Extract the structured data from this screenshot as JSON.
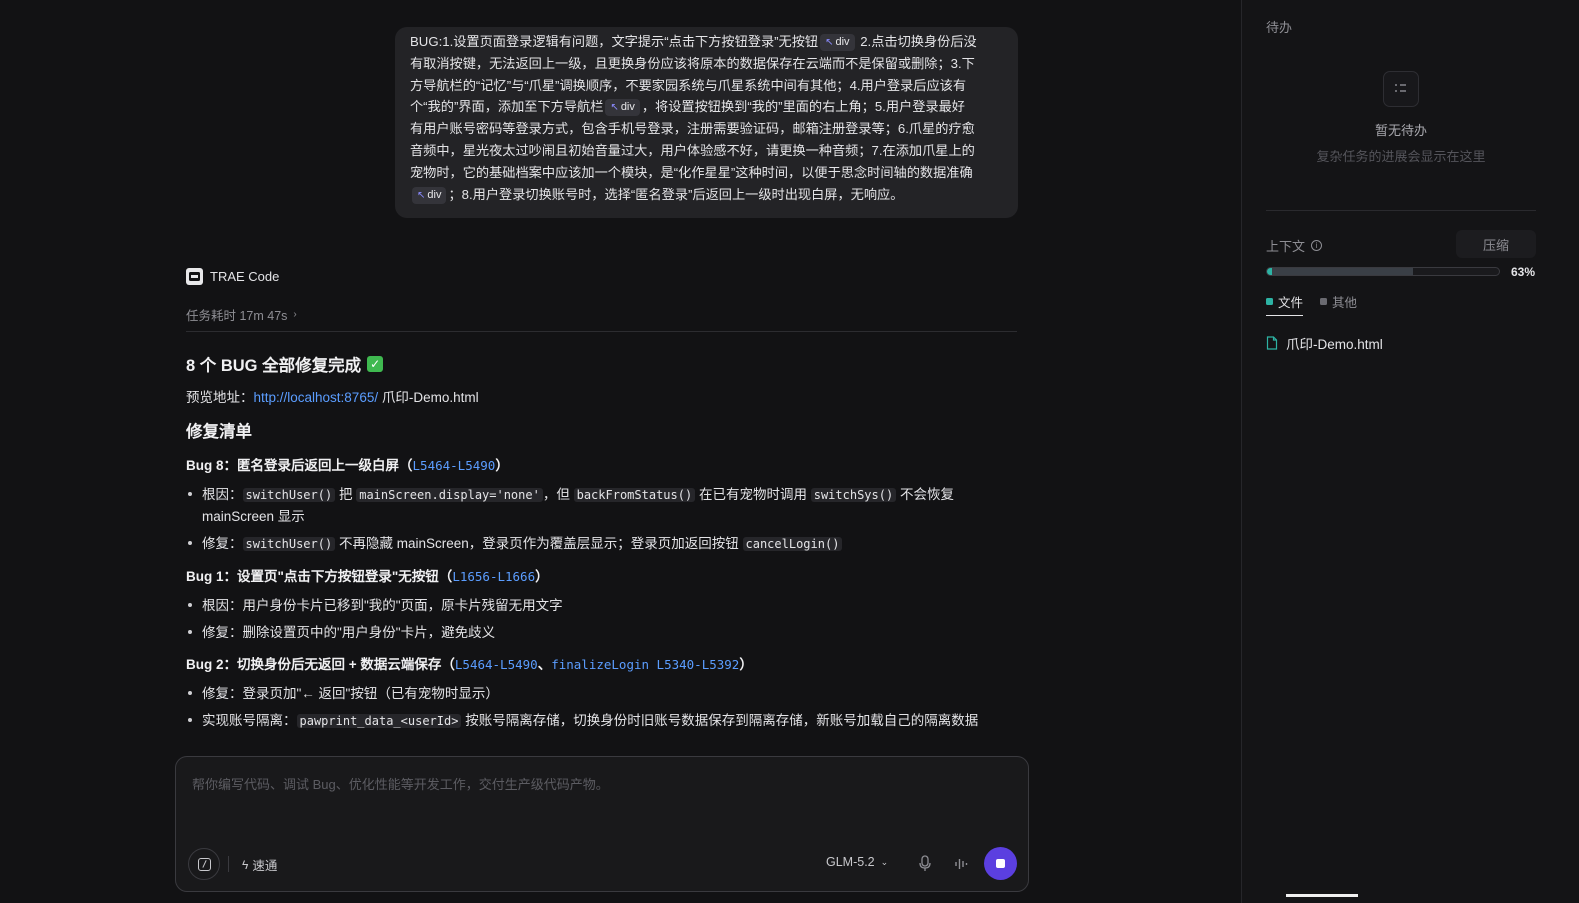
{
  "user_message": {
    "lines": [
      [
        "BUG:1.设置页面登录逻辑有问题，文字提示“点击下方按钮登录”无按钮",
        "chip:div",
        " 2.点击切换身份后没"
      ],
      [
        "有取消按键，无法返回上一级，且更换身份应该将原本的数据保存在云端而不是保留或删除；3.下"
      ],
      [
        "方导航栏的“记忆”与“爪星”调换顺序，不要家园系统与爪星系统中间有其他；4.用户登录后应该有"
      ],
      [
        "个“我的”界面，添加至下方导航栏",
        "chip:div",
        "，将设置按钮换到“我的”里面的右上角；5.用户登录最好"
      ],
      [
        "有用户账号密码等登录方式，包含手机号登录，注册需要验证码，邮箱注册登录等；6.爪星的疗愈"
      ],
      [
        "音频中，星光夜太过吵闹且初始音量过大，用户体验感不好，请更换一种音频；7.在添加爪星上的"
      ],
      [
        "宠物时，它的基础档案中应该加一个模块，是“化作星星”这种时间，以便于思念时间轴的数据准确"
      ],
      [
        "chip:div",
        "；8.用户登录切换账号时，选择“匿名登录”后返回上一级时出现白屏，无响应。"
      ]
    ]
  },
  "agent": {
    "name": "TRAE Code",
    "task_time": "任务耗时 17m 47s",
    "title": "8 个 BUG 全部修复完成",
    "preview_label": "预览地址：",
    "preview_url": "http://localhost:8765/",
    "preview_file": " 爪印-Demo.html",
    "section_title": "修复清单",
    "bugs": [
      {
        "heading": "Bug 8：匿名登录后返回上一级白屏（",
        "refs": "L5464-L5490",
        "bullets": [
          [
            [
              "t",
              "根因："
            ],
            [
              "c",
              "switchUser()"
            ],
            [
              "t",
              " 把 "
            ],
            [
              "c",
              "mainScreen.display='none'"
            ],
            [
              "t",
              "，但 "
            ],
            [
              "c",
              "backFromStatus()"
            ],
            [
              "t",
              " 在已有宠物时调用 "
            ],
            [
              "c",
              "switchSys()"
            ],
            [
              "t",
              " 不会恢复"
            ],
            [
              "br",
              ""
            ],
            [
              "t",
              "mainScreen 显示"
            ]
          ],
          [
            [
              "t",
              "修复："
            ],
            [
              "c",
              "switchUser()"
            ],
            [
              "t",
              " 不再隐藏 mainScreen，登录页作为覆盖层显示；登录页加返回按钮 "
            ],
            [
              "c",
              "cancelLogin()"
            ]
          ]
        ]
      },
      {
        "heading": "Bug 1：设置页\"点击下方按钮登录\"无按钮（",
        "refs": "L1656-L1666",
        "bullets": [
          [
            [
              "t",
              "根因：用户身份卡片已移到\"我的\"页面，原卡片残留无用文字"
            ]
          ],
          [
            [
              "t",
              "修复：删除设置页中的\"用户身份\"卡片，避免歧义"
            ]
          ]
        ]
      },
      {
        "heading": "Bug 2：切换身份后无返回 + 数据云端保存（",
        "refs": "L5464-L5490",
        "refs_sep": "、",
        "refs2": "finalizeLogin L5340-L5392",
        "bullets": [
          [
            [
              "t",
              "修复：登录页加\"← 返回\"按钮（已有宠物时显示）"
            ]
          ],
          [
            [
              "t",
              "实现账号隔离："
            ],
            [
              "c",
              "pawprint_data_<userId>"
            ],
            [
              "t",
              " 按账号隔离存储，切换身份时旧账号数据保存到隔离存储，新账号加载自己的隔离数据"
            ]
          ]
        ]
      }
    ]
  },
  "input": {
    "placeholder": "帮你编写代码、调试 Bug、优化性能等开发工作，交付生产级代码产物。",
    "speed_label": "速通",
    "model": "GLM-5.2"
  },
  "right_panel": {
    "todo_label": "待办",
    "todo_empty": "暂无待办",
    "todo_hint": "复杂任务的进展会显示在这里",
    "context_label": "上下文",
    "compress_label": "压缩",
    "context_progress": 0.63,
    "context_pct": "63%",
    "tab_files": "文件",
    "tab_other": "其他",
    "file_name": "爪印-Demo.html"
  },
  "colors": {
    "accent_purple": "#5b3fe0",
    "link_blue": "#5b9dff",
    "teal": "#2db3a4",
    "check_green": "#3fb950"
  }
}
